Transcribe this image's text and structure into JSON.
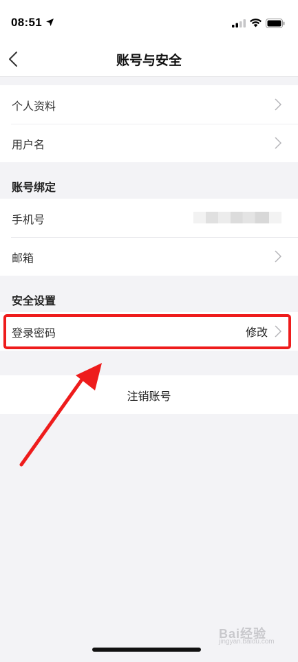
{
  "status_bar": {
    "time": "08:51",
    "icons": [
      "location-arrow-icon",
      "cellular-signal-icon",
      "wifi-icon",
      "battery-icon"
    ]
  },
  "nav": {
    "title": "账号与安全",
    "back_icon": "chevron-left-icon"
  },
  "profile_group": [
    {
      "label": "个人资料"
    },
    {
      "label": "用户名"
    }
  ],
  "binding": {
    "header": "账号绑定",
    "items": [
      {
        "label": "手机号"
      },
      {
        "label": "邮箱"
      }
    ]
  },
  "security": {
    "header": "安全设置",
    "password": {
      "label": "登录密码",
      "action": "修改"
    }
  },
  "deactivate": {
    "label": "注销账号"
  },
  "annotation": {
    "color": "#ee1c1c"
  },
  "watermark": {
    "text": "Bai经验",
    "sub": "jingyan.baidu.com"
  }
}
